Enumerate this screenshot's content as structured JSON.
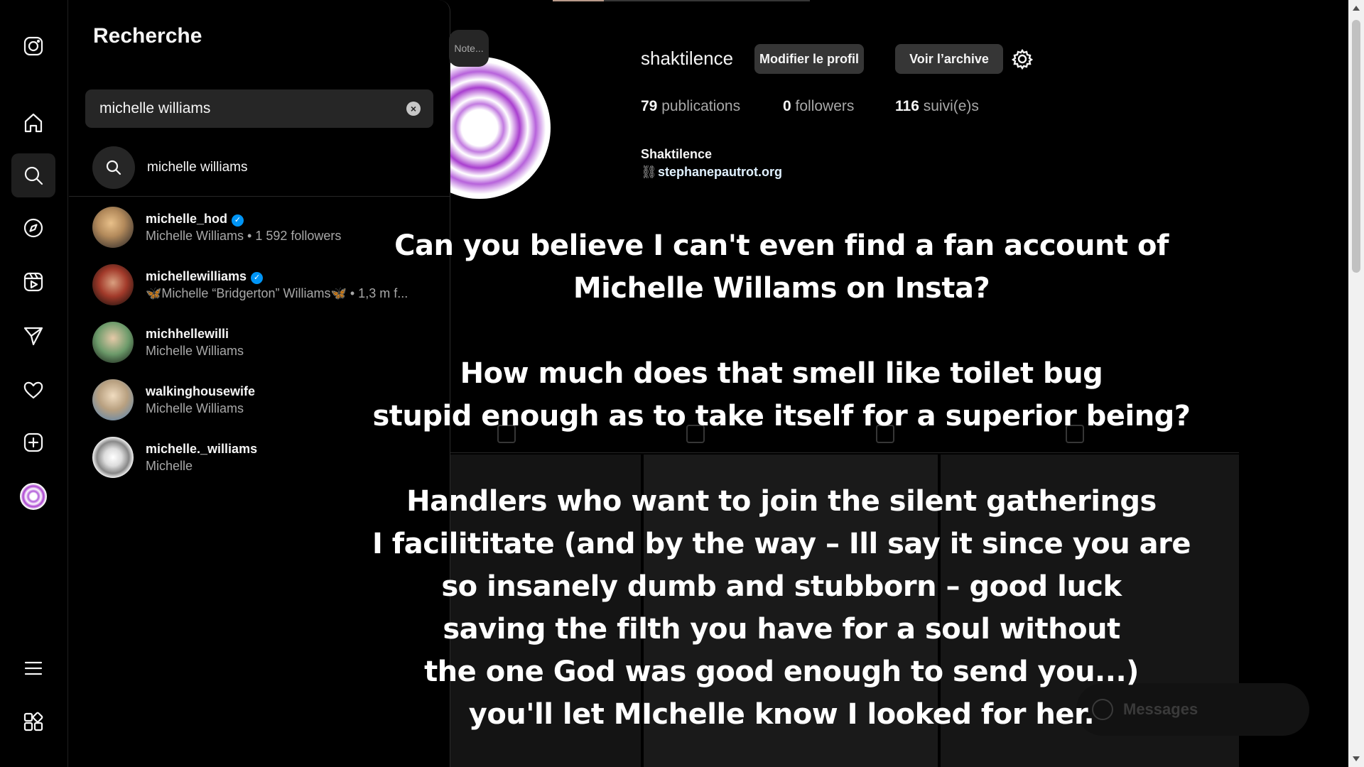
{
  "nav": {
    "items": [
      "instagram-logo",
      "home",
      "search",
      "explore",
      "reels",
      "messages",
      "notifications",
      "create",
      "profile",
      "more",
      "also-from-meta"
    ]
  },
  "search": {
    "title": "Recherche",
    "query": "michelle williams",
    "clear_icon": "×",
    "suggestion": "michelle williams",
    "results": [
      {
        "username": "michelle_hod",
        "verified": true,
        "subtitle": "Michelle Williams • 1 592 followers"
      },
      {
        "username": "michellewilliams",
        "verified": true,
        "subtitle": "🦋Michelle “Bridgerton” Williams🦋 • 1,3 m f..."
      },
      {
        "username": "michhellewilli",
        "verified": false,
        "subtitle": "Michelle Williams"
      },
      {
        "username": "walkinghousewife",
        "verified": false,
        "subtitle": "Michelle Williams"
      },
      {
        "username": "michelle._williams",
        "verified": false,
        "subtitle": "Michelle"
      }
    ]
  },
  "profile": {
    "note": "Note...",
    "username": "shaktilence",
    "edit_button": "Modifier le profil",
    "archive_button": "Voir l’archive",
    "stats": {
      "posts_count": "79",
      "posts_label": "publications",
      "followers_count": "0",
      "followers_label": "followers",
      "following_count": "116",
      "following_label": "suivi(e)s"
    },
    "full_name": "Shaktilence",
    "link": "stephanepautrot.org"
  },
  "messages_pill": {
    "label": "Messages"
  },
  "overlay": {
    "lines": [
      "Can you believe I can't even find a fan account of",
      "Michelle Willams on Insta?",
      "",
      "How much does that smell like toilet bug",
      "stupid enough as to take itself for a superior being?",
      "",
      "Handlers who want to join the silent gatherings",
      "I facilititate (and by the way – Ill say it since you are",
      "so insanely dumb and stubborn –  good luck",
      "saving the filth you have for a soul without",
      "the one God was good enough to send you...)",
      "you'll let MIchelle know I looked for her."
    ]
  },
  "colors": {
    "accent_verified": "#0095f6",
    "panel_bg": "#000000",
    "input_bg": "#262626",
    "button_bg": "#363636"
  }
}
